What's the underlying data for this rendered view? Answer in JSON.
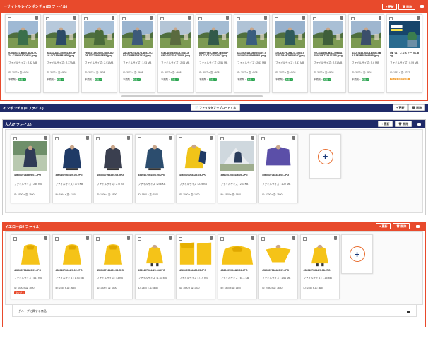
{
  "top_section": {
    "title": "ーサイトルレインポンチョ(20 ファイル)",
    "update_label": "+ 更新",
    "delete_label": "🗑 削除",
    "cards": [
      {
        "filename": "975AB110-B880-4823-9C7A-C2860A5DDE32.jpeg",
        "size": "ファイルサイズ : 2.92 MB",
        "dims": "ID: 3072 x 高: 4608",
        "std": "不規則"
      },
      {
        "filename": "B82AAA43-3559-4760-8F1C-CC1898EB2976.jpeg",
        "size": "ファイルサイズ : 2.37 MB",
        "dims": "ID: 3072 x 高: 4608",
        "std": "不規則"
      },
      {
        "filename": "7E6E27A6-2808-4869-8DD8-17D76E6B1EF5.jpeg",
        "size": "ファイルサイズ : 2.91 MB",
        "dims": "ID: 3072 x 高: 4608",
        "std": "不規則"
      },
      {
        "filename": "2ACEFAE4-2178-4657-9CD2-C38BF9D9752A.jpeg",
        "size": "ファイルサイズ : 1.93 MB",
        "dims": "ID: 3072 x 高: 4608",
        "std": "不規則"
      },
      {
        "filename": "91EDD4E6-59C5-4044-ACBD-30CF54276849.jpeg",
        "size": "ファイルサイズ : 2.04 MB",
        "dims": "ID: 3072 x 高: 4608",
        "std": "不規則"
      },
      {
        "filename": "85DFF9E0-3B6F-4E55-8FD1-C7C11C5241AC.jpeg",
        "size": "ファイルサイズ : 2.51 MB",
        "dims": "ID: 3072 x 高: 4608",
        "std": "不規則"
      },
      {
        "filename": "DC35DEA3-DEE9-4397-9303-971A8E96B3F8.jpeg",
        "size": "ファイルサイズ : 2.63 MB",
        "dims": "ID: 3072 x 高: 4608",
        "std": "不規則"
      },
      {
        "filename": "19C6A1F6-ABCC-4E53-921D-DA6B76F8974C.jpeg",
        "size": "ファイルサイズ : 2.57 MB",
        "dims": "ID: 3072 x 高: 4608",
        "std": "不規則"
      },
      {
        "filename": "E6C47D89-DB4D-4968-AEB0-24E773A327E5.jpeg",
        "size": "ファイルサイズ : 2.21 MB",
        "dims": "ID: 3072 x 高: 4608",
        "std": "不規則"
      },
      {
        "filename": "41C67146-B1C4-4E08-9BA1-5E5B3E96695B.jpeg",
        "size": "ファイルサイズ : 2.6 MB",
        "dims": "ID: 3072 x 高: 4608",
        "std": "不規則"
      },
      {
        "filename": "[仮_01]_レコメド一_01.jpeg",
        "size": "ファイルサイズ : 0.59 MB",
        "dims": "ID: 1152 x 高: 2272",
        "std": "サイズ調整が必要"
      }
    ]
  },
  "middle_section": {
    "title": "インポンチョ(0 ファイル)",
    "upload_label": "📄 ファイルをアップロードする",
    "update_label": "+ 更新",
    "delete_label": "🗑 削除"
  },
  "adult_section": {
    "title": "大人(7 ファイル)",
    "update_label": "+ 更新",
    "delete_label": "🗑 削除",
    "cards": [
      {
        "filename": "4560407064409.01.JPG",
        "size": "ファイルサイズ : 286 KB",
        "dims": "ID: 1500 x 高: 1500"
      },
      {
        "filename": "4560407064409.05.JPG",
        "size": "ファイルサイズ : 375 KB",
        "dims": "ID: 1964 x 高: 1160"
      },
      {
        "filename": "4560407064395.05.JPG",
        "size": "ファイルサイズ : 272 KB",
        "dims": "ID: 1600 x 高: 1500"
      },
      {
        "filename": "4560407064403.05.JPG",
        "size": "ファイルサイズ : 246 KB",
        "dims": "ID: 1500 x 高: 1500"
      },
      {
        "filename": "4560407064429.05.JPG",
        "size": "ファイルサイズ : 239 KB",
        "dims": "ID: 1000 x 高: 1500"
      },
      {
        "filename": "4560407064436.05.JPG",
        "size": "ファイルサイズ : 287 KB",
        "dims": "ID: 1500 x 高: 1500"
      },
      {
        "filename": "4560407064443.05.JPG",
        "size": "ファイルサイズ : 1.22 MB",
        "dims": "ID: 1300 x 高: 1500"
      }
    ]
  },
  "yellow_section": {
    "title": "イエロー(10 ファイル)",
    "update_label": "+ 更新",
    "delete_label": "🗑 削除",
    "cards": [
      {
        "filename": "4560407064420.01.JPG",
        "size": "ファイルサイズ : 441 KB",
        "dims": "ID: 1500 x 高: 1500",
        "tag": "タイプ ×"
      },
      {
        "filename": "4560407064420.02.JPG",
        "size": "ファイルサイズ : 1.93 MB",
        "dims": "ID: 2450 x 高: 2680"
      },
      {
        "filename": "4560407064420.03.JPG",
        "size": "ファイルサイズ : 43 KB",
        "dims": "ID: 1500 x 高: 1500"
      },
      {
        "filename": "4560407064420.04.JPG",
        "size": "ファイルサイズ : 1.63 MB",
        "dims": "ID: 2450 x 高: 3680"
      },
      {
        "filename": "4560407064420.05.JPG",
        "size": "ファイルサイズ : 77.9 KB",
        "dims": "ID: 1500 x 高: 1500"
      },
      {
        "filename": "4560407064420.06.JPG",
        "size": "ファイルサイズ : 61.1 KB",
        "dims": "ID: 1800 x 高: 1500"
      },
      {
        "filename": "4560407064420.07.JPG",
        "size": "ファイルサイズ : 1.61 MB",
        "dims": "ID: 2450 x 高: 3680"
      },
      {
        "filename": "4560407064420.08.JPG",
        "size": "ファイルサイズ : 1.15 MB",
        "dims": "ID: 2450 x 高: 3680"
      }
    ],
    "group_label": "グループに属する商品"
  },
  "colors": {
    "navy": "#1f2a68",
    "orange": "#e84a2c",
    "green": "#2aa44f"
  }
}
